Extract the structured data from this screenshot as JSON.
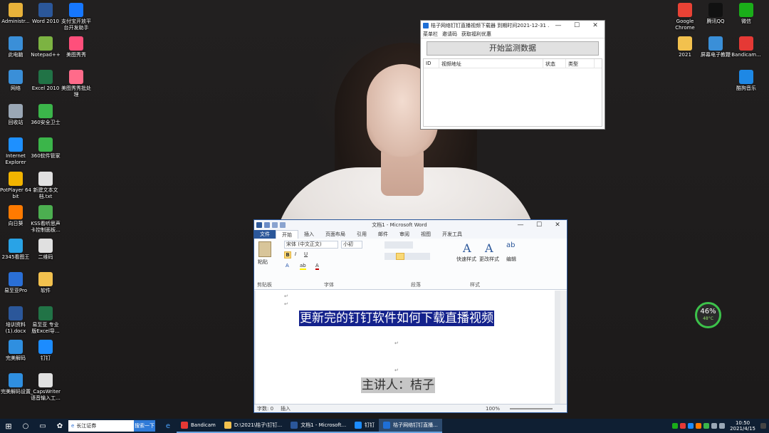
{
  "desktop": {
    "left_icons": [
      {
        "label": "Administr...",
        "icon": "user-folder-icon",
        "color": "#e8b23a"
      },
      {
        "label": "Word 2010",
        "icon": "word-icon",
        "color": "#2b579a"
      },
      {
        "label": "支付宝开放平台开发助手",
        "icon": "alipay-icon",
        "color": "#1677ff"
      },
      {
        "label": "此电脑",
        "icon": "computer-icon",
        "color": "#3a8fd8"
      },
      {
        "label": "Notepad++",
        "icon": "notepad-icon",
        "color": "#7cb342"
      },
      {
        "label": "美图秀秀",
        "icon": "meitu-icon",
        "color": "#ff4f7b"
      },
      {
        "label": "网络",
        "icon": "network-icon",
        "color": "#3a8fd8"
      },
      {
        "label": "Excel 2010",
        "icon": "excel-icon",
        "color": "#217346"
      },
      {
        "label": "美图秀秀批处理",
        "icon": "meitu-batch-icon",
        "color": "#ff6b8a"
      },
      {
        "label": "回收站",
        "icon": "recycle-bin-icon",
        "color": "#9aa7b5"
      },
      {
        "label": "360安全卫士",
        "icon": "360-safe-icon",
        "color": "#3bb54a"
      },
      {
        "label": "Internet Explorer",
        "icon": "ie-icon",
        "color": "#1e90ff"
      },
      {
        "label": "360软件管家",
        "icon": "360-manager-icon",
        "color": "#3bb54a"
      },
      {
        "label": "PotPlayer 64 bit",
        "icon": "potplayer-icon",
        "color": "#f2b400"
      },
      {
        "label": "新建文本文档.txt",
        "icon": "text-file-icon",
        "color": "#e0e0e0"
      },
      {
        "label": "向日葵",
        "icon": "sunflower-icon",
        "color": "#ff7a00"
      },
      {
        "label": "KSS看听思声卡控制面板...",
        "icon": "kss-icon",
        "color": "#4caf50"
      },
      {
        "label": "2345看图王",
        "icon": "2345-viewer-icon",
        "color": "#29a3e6"
      },
      {
        "label": "二维码",
        "icon": "qrcode-file-icon",
        "color": "#e0e0e0"
      },
      {
        "label": "易至亚Pro",
        "icon": "pro-app-icon",
        "color": "#2a6fd6"
      },
      {
        "label": "软件",
        "icon": "folder-icon",
        "color": "#f2c14e"
      },
      {
        "label": "培训资料(1).docx",
        "icon": "docx-icon",
        "color": "#2b579a"
      },
      {
        "label": "易至亚 专业版Excel导...",
        "icon": "excel-export-icon",
        "color": "#217346"
      },
      {
        "label": "完美解码",
        "icon": "potdecode-icon",
        "color": "#2f8fe0"
      },
      {
        "label": "钉钉",
        "icon": "dingtalk-icon",
        "color": "#1c8cff"
      },
      {
        "label": "完美解码设置",
        "icon": "potdecode-settings-icon",
        "color": "#2f8fe0"
      },
      {
        "label": "_CapsWriter语音输入工...",
        "icon": "capswriter-icon",
        "color": "#e0e0e0"
      }
    ],
    "right_icons": [
      {
        "label": "Google Chrome",
        "icon": "chrome-icon",
        "color": "#e94235"
      },
      {
        "label": "腾讯QQ",
        "icon": "qq-icon",
        "color": "#111111"
      },
      {
        "label": "微信",
        "icon": "wechat-icon",
        "color": "#1aad19"
      },
      {
        "label": "2021",
        "icon": "folder-2021-icon",
        "color": "#f2c14e"
      },
      {
        "label": "屏幕电子教鞭",
        "icon": "screen-pointer-icon",
        "color": "#3a8fd8"
      },
      {
        "label": "Bandicam...",
        "icon": "bandicam-icon",
        "color": "#e53935"
      },
      {
        "label": "酷狗音乐",
        "icon": "kugou-icon",
        "color": "#1e88e5"
      }
    ]
  },
  "monitor_window": {
    "title": "桔子网络钉钉直播视频下载器 到期时间2021-12-31 ...",
    "menu": [
      "菜单栏",
      "邀请码",
      "获取福利优惠"
    ],
    "start_button": "开始监测数据",
    "columns": [
      "ID",
      "视频地址",
      "状态",
      "类型"
    ]
  },
  "word": {
    "title": "文档1 - Microsoft Word",
    "tabs": [
      "文件",
      "开始",
      "插入",
      "页面布局",
      "引用",
      "邮件",
      "审阅",
      "视图",
      "开发工具"
    ],
    "ribbon": {
      "paste": "粘贴",
      "font_name": "宋体 (中文正文)",
      "font_size": "小初",
      "quick_styles": "快速样式",
      "change_styles": "更改样式",
      "edit": "编辑",
      "groups": [
        "剪贴板",
        "字体",
        "段落",
        "样式"
      ]
    },
    "doc_line1": "更新完的钉钉软件如何下载直播视频",
    "doc_line2": "主讲人：桔子",
    "status": {
      "words": "字数: 0",
      "mode": "插入",
      "zoom": "100%"
    }
  },
  "perf_widget": {
    "percent": "46%",
    "temp": "48°C"
  },
  "taskbar": {
    "search_text": "长江证券",
    "search_button": "搜索一下",
    "apps": [
      {
        "label": "Bandicam",
        "color": "#e53935",
        "active": false
      },
      {
        "label": "D:\\2021\\桔子\\钉钉...",
        "color": "#f2c14e",
        "active": false
      },
      {
        "label": "文档1 - Microsoft...",
        "color": "#2b579a",
        "active": false
      },
      {
        "label": "钉钉",
        "color": "#1c8cff",
        "active": false
      },
      {
        "label": "桔子网络钉钉直播...",
        "color": "#1f6fd6",
        "active": true
      }
    ],
    "time": "10:50",
    "date": "2021/4/15"
  }
}
